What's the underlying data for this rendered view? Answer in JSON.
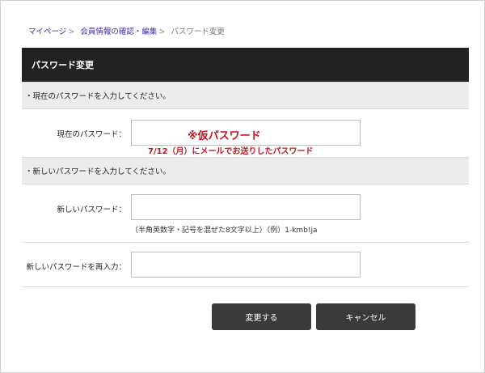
{
  "breadcrumb": {
    "item1": "マイページ",
    "item2": "会員情報の確認・編集",
    "current": "パスワード変更",
    "separator": ">"
  },
  "header": {
    "title": "パスワード変更"
  },
  "sections": {
    "current": "・現在のパスワードを入力してください。",
    "new": "・新しいパスワードを入力してください。"
  },
  "fields": {
    "current_password_label": "現在のパスワード：",
    "new_password_label": "新しいパスワード：",
    "confirm_password_label": "新しいパスワードを再入力：",
    "current_password_value": "",
    "new_password_value": "",
    "confirm_password_value": ""
  },
  "hint": "（半角英数字・記号を混ぜた8文字以上）（例）1-kmb!ja",
  "annotation": {
    "line1": "※仮パスワード",
    "line2": "7/12（月）にメールでお送りしたパスワード",
    "color": "#c8141e"
  },
  "buttons": {
    "submit": "変更する",
    "cancel": "キャンセル"
  }
}
